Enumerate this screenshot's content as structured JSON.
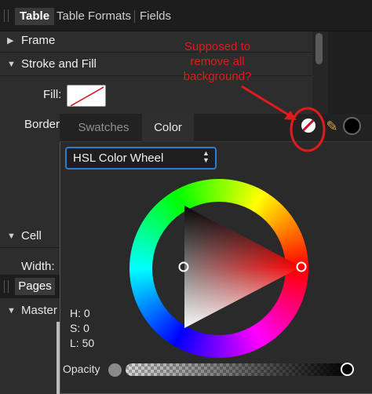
{
  "tabs": [
    "Table",
    "Table Formats",
    "Fields"
  ],
  "sections": {
    "frame": "Frame",
    "stroke_fill": "Stroke and Fill",
    "fill_label": "Fill:",
    "border_label": "Border",
    "cell": "Cell",
    "width_label": "Width:"
  },
  "pages_panel": {
    "tab": "Pages",
    "master": "Master"
  },
  "color_popover": {
    "tabs": [
      "Swatches",
      "Color"
    ],
    "active_tab": "Color",
    "mode": "HSL Color Wheel",
    "hsl": {
      "h": "H: 0",
      "s": "S: 0",
      "l": "L: 50"
    },
    "opacity_label": "Opacity"
  },
  "annotation": {
    "text": "Supposed to remove all background?",
    "color": "#e11b1b"
  },
  "colors": {
    "accent": "#2e7bd1",
    "annotation": "#e11b1b",
    "panel": "#2d2d2d"
  },
  "icons": [
    "disclosure-triangle-icon",
    "no-fill-icon",
    "eyedropper-icon",
    "color-swatch-icon"
  ]
}
